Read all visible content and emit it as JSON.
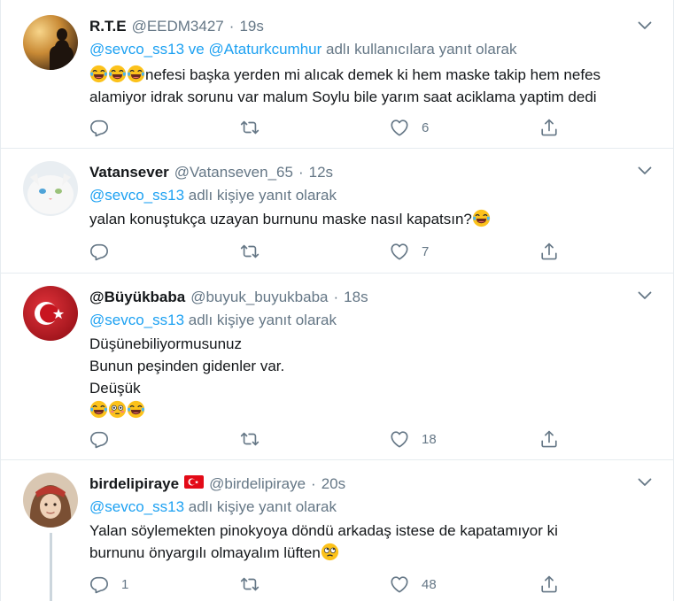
{
  "tweets": [
    {
      "name": "R.T.E",
      "handle": "@EEDM3427",
      "time": "19s",
      "reply_mentions": [
        "@sevco_ss13",
        "@Ataturkcumhur"
      ],
      "reply_joiner": "ve",
      "reply_suffix": "adlı kullanıcılara yanıt olarak",
      "lines": [
        "nefesi başka yerden mi alıcak demek ki hem maske takip hem nefes",
        "alamiyor idrak sorunu var malum Soylu bile yarım saat aciklama yaptim dedi"
      ],
      "reply_count": "",
      "like_count": "6"
    },
    {
      "name": "Vatansever",
      "handle": "@Vatanseven_65",
      "time": "12s",
      "reply_mentions": [
        "@sevco_ss13"
      ],
      "reply_suffix": "adlı kişiye yanıt olarak",
      "lines": [
        "yalan konuştukça uzayan burnunu maske nasıl kapatsın?"
      ],
      "reply_count": "",
      "like_count": "7"
    },
    {
      "name": "@Büyükbaba",
      "handle": "@buyuk_buyukbaba",
      "time": "18s",
      "reply_mentions": [
        "@sevco_ss13"
      ],
      "reply_suffix": "adlı kişiye yanıt olarak",
      "lines": [
        "Düşünebiliyormusunuz",
        "Bunun peşinden gidenler var.",
        "Deüşük"
      ],
      "reply_count": "",
      "like_count": "18"
    },
    {
      "name": "birdelipiraye",
      "handle": "@birdelipiraye",
      "time": "20s",
      "reply_mentions": [
        "@sevco_ss13"
      ],
      "reply_suffix": "adlı kişiye yanıt olarak",
      "lines": [
        "Yalan söylemekten pinokyoya döndü arkadaş istese de kapatamıyor ki",
        "burnunu önyargılı olmayalım lüften"
      ],
      "reply_count": "1",
      "like_count": "48"
    }
  ],
  "separator": "·",
  "icons": {
    "reply": "reply-icon",
    "retweet": "retweet-icon",
    "like": "like-icon",
    "share": "share-icon",
    "caret": "caret-down-icon",
    "laugh": "tears-of-joy-emoji",
    "flushed": "flushed-face-emoji",
    "rolling": "rolling-eyes-emoji",
    "flag": "turkey-flag-icon"
  },
  "colors": {
    "link": "#1da1f2",
    "secondary": "#657786",
    "text": "#14171a",
    "border": "#e6ecf0",
    "thread": "#ccd6dd"
  }
}
